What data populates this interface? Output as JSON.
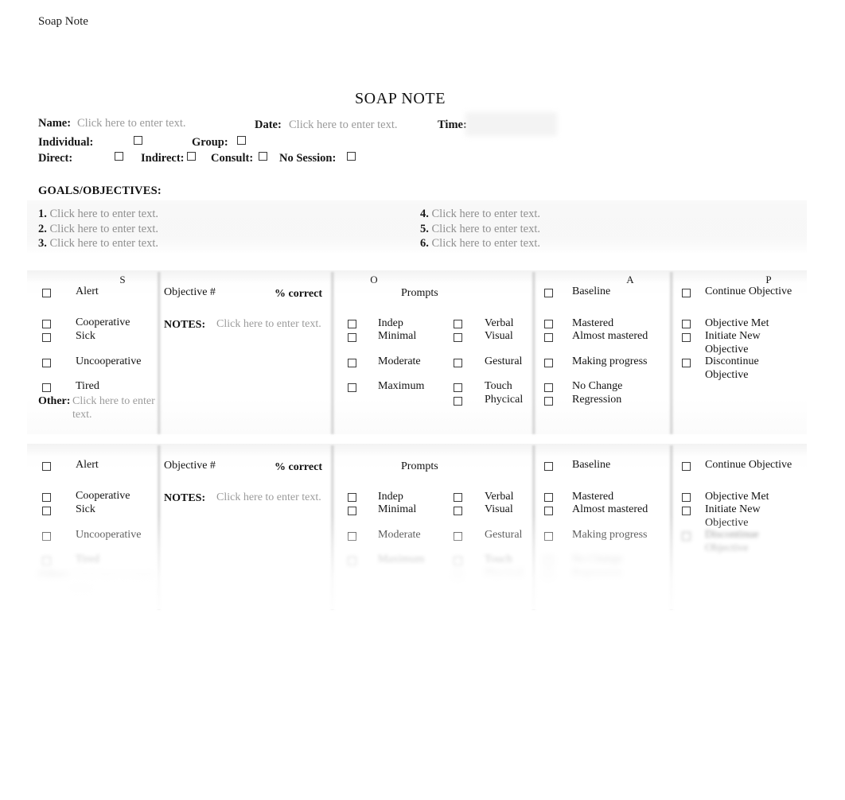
{
  "document": {
    "name": "Soap Note",
    "title": "SOAP NOTE"
  },
  "header": {
    "name_label": "Name:",
    "name_placeholder": "Click here to enter text.",
    "date_label": "Date:",
    "date_placeholder": "Click here to enter text.",
    "time_label": "Time:",
    "time_value": "",
    "individual_label": "Individual:",
    "group_label": "Group:",
    "direct_label": "Direct:",
    "indirect_label": "Indirect:",
    "consult_label": "Consult:",
    "no_session_label": "No Session:"
  },
  "goals": {
    "heading": "GOALS/OBJECTIVES:",
    "placeholder": "Click here to enter text.",
    "left": [
      {
        "num": "1.",
        "text": "Click here to enter text."
      },
      {
        "num": "2.",
        "text": "Click here to enter text."
      },
      {
        "num": "3.",
        "text": "Click here to enter text."
      }
    ],
    "right": [
      {
        "num": "4.",
        "text": "Click here to enter text."
      },
      {
        "num": "5.",
        "text": "Click here to enter text."
      },
      {
        "num": "6.",
        "text": "Click here to enter text."
      }
    ]
  },
  "soap_table": {
    "section_headers": {
      "s": "S",
      "o": "O",
      "a": "A",
      "p": "P"
    },
    "subjective": {
      "items": [
        "Alert",
        "Cooperative",
        "Sick",
        "Uncooperative",
        "Tired"
      ],
      "other_label": "Other:",
      "other_placeholder": "Click here to enter text."
    },
    "objective": {
      "objective_number_label": "Objective #",
      "percent_correct_label": "% correct",
      "notes_label": "NOTES:",
      "notes_placeholder": "Click here to enter text.",
      "prompts_label": "Prompts",
      "prompt_level": [
        "Indep",
        "Minimal",
        "Moderate",
        "Maximum"
      ],
      "prompt_type": [
        "Verbal",
        "Visual",
        "Gestural",
        "Touch",
        "Phycical"
      ]
    },
    "assessment": {
      "items": [
        "Baseline",
        "Mastered",
        "Almost mastered",
        "Making progress",
        "No Change",
        "Regression"
      ]
    },
    "plan": {
      "items": [
        "Continue Objective",
        "Objective Met",
        "Initiate New Objective",
        "Discontinue Objective"
      ]
    }
  }
}
